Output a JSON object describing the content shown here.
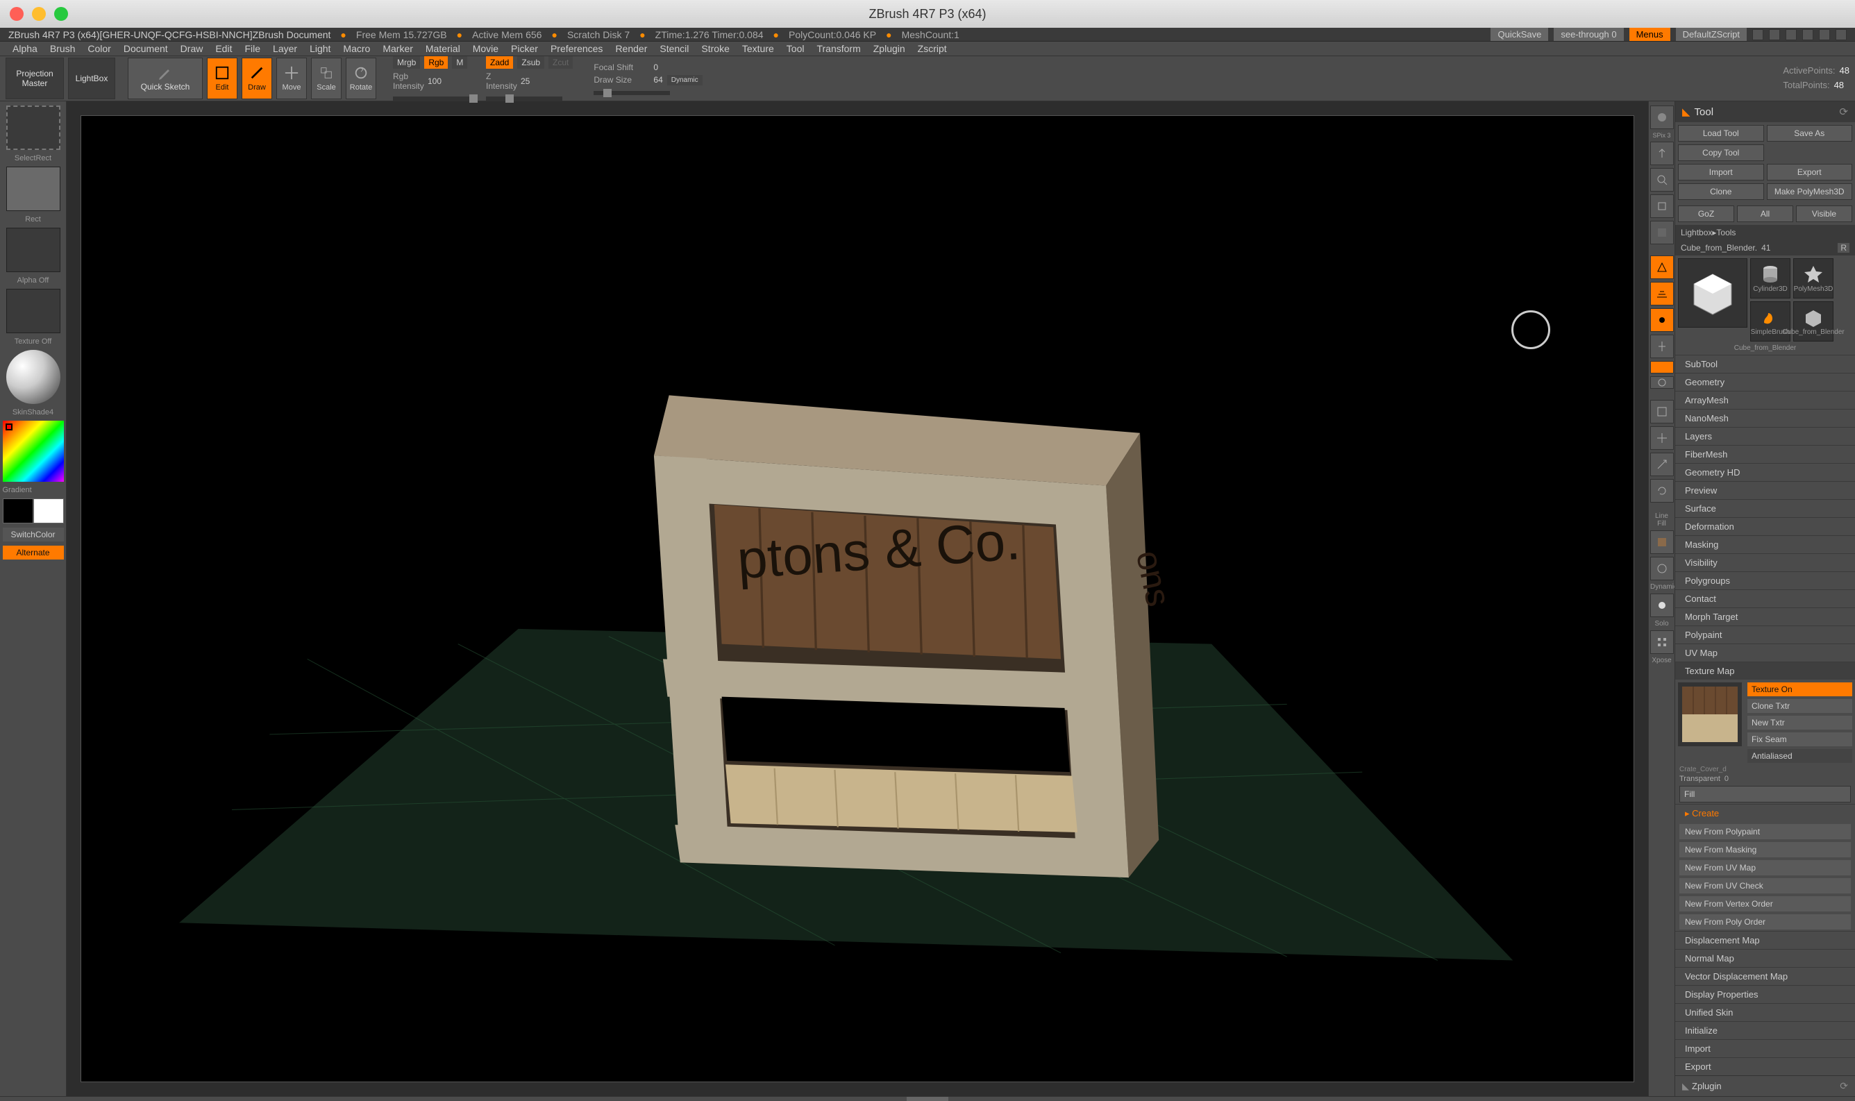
{
  "window": {
    "title": "ZBrush 4R7 P3 (x64)"
  },
  "infostrip": {
    "path": "ZBrush 4R7 P3 (x64)[GHER-UNQF-QCFG-HSBI-NNCH]ZBrush Document",
    "stats": [
      "Free Mem 15.727GB",
      "Active Mem 656",
      "Scratch Disk 7",
      "ZTime:1.276 Timer:0.084",
      "PolyCount:0.046 KP",
      "MeshCount:1"
    ],
    "quicksave": "QuickSave",
    "seethrough": "see-through  0",
    "menus": "Menus",
    "script": "DefaultZScript"
  },
  "menus": [
    "Alpha",
    "Brush",
    "Color",
    "Document",
    "Draw",
    "Edit",
    "File",
    "Layer",
    "Light",
    "Macro",
    "Marker",
    "Material",
    "Movie",
    "Picker",
    "Preferences",
    "Render",
    "Stencil",
    "Stroke",
    "Texture",
    "Tool",
    "Transform",
    "Zplugin",
    "Zscript"
  ],
  "toolbar": {
    "projection": "Projection Master",
    "lightbox": "LightBox",
    "quicksketch": "Quick Sketch",
    "edit": "Edit",
    "draw": "Draw",
    "move": "Move",
    "scale": "Scale",
    "rotate": "Rotate",
    "mrgb": "Mrgb",
    "rgb": "Rgb",
    "m": "M",
    "rgb_intensity_lbl": "Rgb Intensity",
    "rgb_intensity_val": "100",
    "zadd": "Zadd",
    "zsub": "Zsub",
    "zcut": "Zcut",
    "z_intensity_lbl": "Z Intensity",
    "z_intensity_val": "25",
    "focal_shift_lbl": "Focal Shift",
    "focal_shift_val": "0",
    "draw_size_lbl": "Draw Size",
    "draw_size_val": "64",
    "dynamic": "Dynamic",
    "activepts_lbl": "ActivePoints:",
    "activepts_val": "48",
    "totalpts_lbl": "TotalPoints:",
    "totalpts_val": "48"
  },
  "leftpal": {
    "selectrect": "SelectRect",
    "rect": "Rect",
    "alpha_off": "Alpha Off",
    "texture_off": "Texture Off",
    "matshader": "SkinShade4",
    "gradient": "Gradient",
    "switchcolor": "SwitchColor",
    "alternate": "Alternate"
  },
  "rightmini": {
    "items": [
      "BPR",
      "Scroll",
      "Zoom",
      "Actual",
      "AAHalf",
      "Persp",
      "Floor",
      "Local",
      "LSym",
      "Xpose",
      "Frame",
      "Move",
      "Scale",
      "Rotate",
      "LineFill",
      "PolyF",
      "Transp",
      "Ghost",
      "Solo",
      "Xpose2"
    ]
  },
  "toolpanel": {
    "head": "Tool",
    "row1": {
      "load": "Load Tool",
      "saveas": "Save As"
    },
    "row2": {
      "copy": "Copy Tool"
    },
    "row3": {
      "import": "Import",
      "export": "Export"
    },
    "row4": {
      "clone": "Clone",
      "makepoly": "Make PolyMesh3D"
    },
    "row5": {
      "goz": "GoZ",
      "all": "All",
      "visible": "Visible"
    },
    "lightbox": "Lightbox▸Tools",
    "current": "Cube_from_Blender.",
    "current_n": "41",
    "r": "R",
    "thumbs": [
      {
        "label": "Cube_from_Blender"
      },
      {
        "label": "Cylinder3D"
      },
      {
        "label": "PolyMesh3D"
      },
      {
        "label": "SimpleBrush"
      },
      {
        "label": "Cube_from_Blender"
      }
    ],
    "accordions": [
      "SubTool",
      "Geometry",
      "ArrayMesh",
      "NanoMesh",
      "Layers",
      "FiberMesh",
      "Geometry HD",
      "Preview",
      "Surface",
      "Deformation",
      "Masking",
      "Visibility",
      "Polygroups",
      "Contact",
      "Morph Target",
      "Polypaint",
      "UV Map"
    ],
    "texmap": {
      "title": "Texture Map",
      "texture_on": "Texture On",
      "clone_txtr": "Clone Txtr",
      "new_txtr": "New Txtr",
      "fix_seam": "Fix Seam",
      "antialiased": "Antialiased",
      "thumb_label": "Crate_Cover_d",
      "transparent": "Transparent",
      "transparent_val": "0",
      "fill": "Fill"
    },
    "create": {
      "title": "Create",
      "items": [
        "New From Polypaint",
        "New From Masking",
        "New From UV Map",
        "New From UV Check",
        "New From Vertex Order",
        "New From Poly Order"
      ]
    },
    "accordions2": [
      "Displacement Map",
      "Normal Map",
      "Vector Displacement Map",
      "Display Properties",
      "Unified Skin",
      "Initialize",
      "Import",
      "Export"
    ],
    "zplugin": "Zplugin"
  }
}
